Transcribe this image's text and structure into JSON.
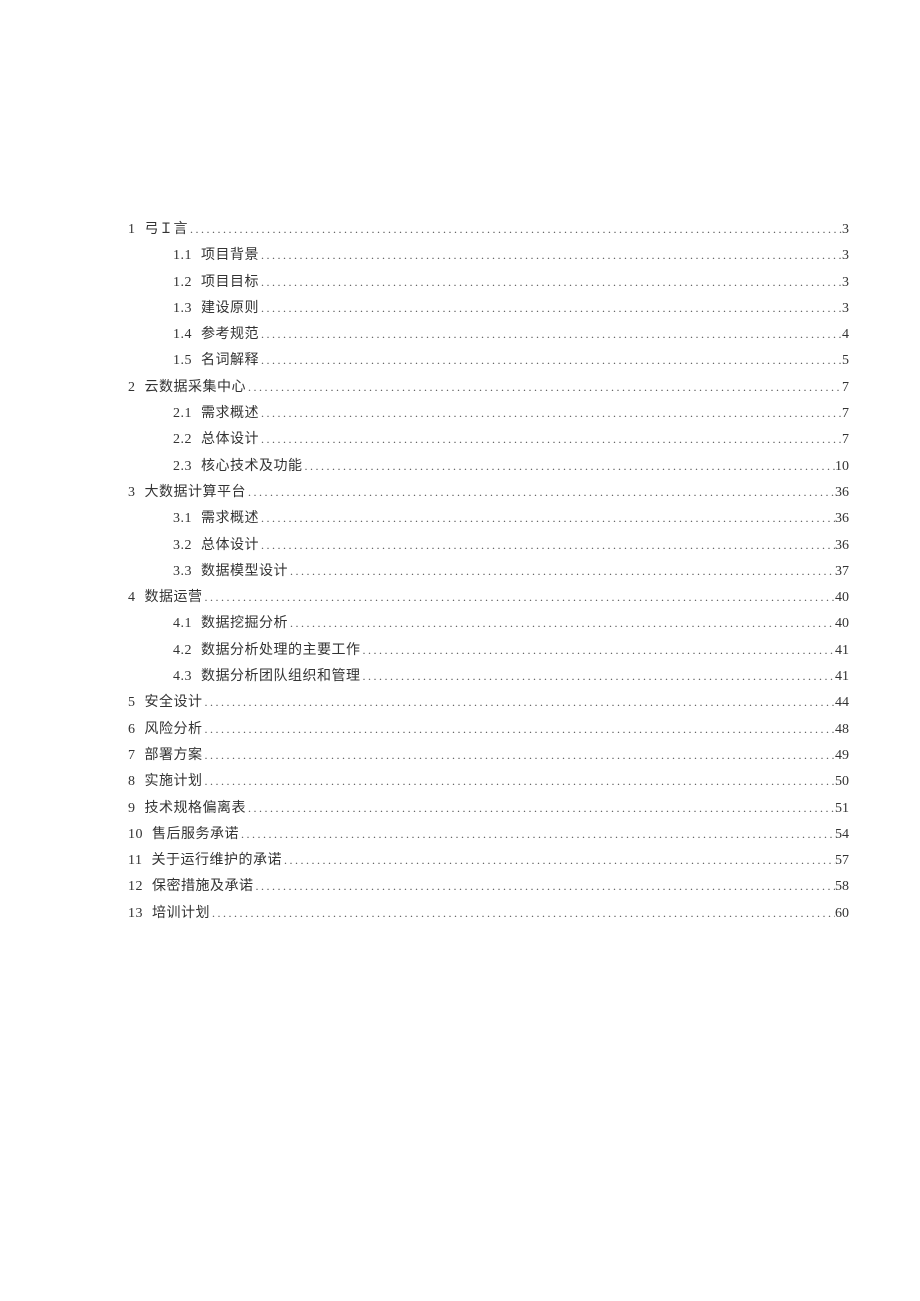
{
  "toc": [
    {
      "level": 0,
      "num": "1",
      "title": "弓Ｉ言",
      "page": "3"
    },
    {
      "level": 1,
      "num": "1.1",
      "title": "项目背景",
      "page": "3"
    },
    {
      "level": 1,
      "num": "1.2",
      "title": "项目目标",
      "page": "3"
    },
    {
      "level": 1,
      "num": "1.3",
      "title": "建设原则",
      "page": "3"
    },
    {
      "level": 1,
      "num": "1.4",
      "title": "参考规范",
      "page": "4"
    },
    {
      "level": 1,
      "num": "1.5",
      "title": "名词解释",
      "page": "5"
    },
    {
      "level": 0,
      "num": "2",
      "title": "云数据采集中心",
      "page": "7"
    },
    {
      "level": 1,
      "num": "2.1",
      "title": "需求概述",
      "page": "7"
    },
    {
      "level": 1,
      "num": "2.2",
      "title": "总体设计",
      "page": "7"
    },
    {
      "level": 1,
      "num": "2.3",
      "title": "核心技术及功能",
      "page": "10"
    },
    {
      "level": 0,
      "num": "3",
      "title": "大数据计算平台",
      "page": "36"
    },
    {
      "level": 1,
      "num": "3.1",
      "title": "需求概述",
      "page": "36"
    },
    {
      "level": 1,
      "num": "3.2",
      "title": "总体设计",
      "page": "36"
    },
    {
      "level": 1,
      "num": "3.3",
      "title": "数据模型设计",
      "page": "37"
    },
    {
      "level": 0,
      "num": "4",
      "title": "数据运营",
      "page": "40"
    },
    {
      "level": 1,
      "num": "4.1",
      "title": "数据挖掘分析",
      "page": "40"
    },
    {
      "level": 1,
      "num": "4.2",
      "title": "数据分析处理的主要工作",
      "page": "41"
    },
    {
      "level": 1,
      "num": "4.3",
      "title": "数据分析团队组织和管理",
      "page": "41"
    },
    {
      "level": 0,
      "num": "5",
      "title": "安全设计",
      "page": "44"
    },
    {
      "level": 0,
      "num": "6",
      "title": "风险分析",
      "page": "48"
    },
    {
      "level": 0,
      "num": "7",
      "title": "部署方案",
      "page": "49"
    },
    {
      "level": 0,
      "num": "8",
      "title": "实施计划",
      "page": "50"
    },
    {
      "level": 0,
      "num": "9",
      "title": "技术规格偏离表",
      "page": "51"
    },
    {
      "level": 0,
      "num": "10",
      "title": "售后服务承诺",
      "page": "54"
    },
    {
      "level": 0,
      "num": "11",
      "title": "关于运行维护的承诺",
      "page": "57"
    },
    {
      "level": 0,
      "num": "12",
      "title": "保密措施及承诺",
      "page": "58"
    },
    {
      "level": 0,
      "num": "13",
      "title": "培训计划",
      "page": "60"
    }
  ]
}
